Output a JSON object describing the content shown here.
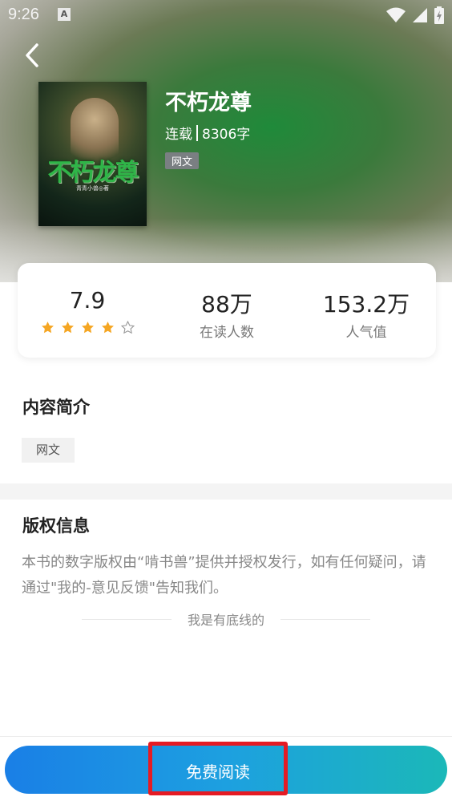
{
  "status_bar": {
    "time": "9:26",
    "notification_icon": "A"
  },
  "book": {
    "title": "不朽龙尊",
    "status": "连载",
    "word_count": "8306字",
    "tag": "网文",
    "cover_title": "不朽龙尊",
    "cover_author": "青青小兽◎著"
  },
  "stats": {
    "rating": "7.9",
    "rating_stars": 4,
    "readers_value": "88万",
    "readers_label": "在读人数",
    "popularity_value": "153.2万",
    "popularity_label": "人气值"
  },
  "intro": {
    "title": "内容简介",
    "tag": "网文"
  },
  "copyright": {
    "title": "版权信息",
    "text": "本书的数字版权由“啃书兽”提供并授权发行，如有任何疑问，请通过\"我的-意见反馈\"告知我们。"
  },
  "end_marker": "我是有底线的",
  "read_button": "免费阅读",
  "colors": {
    "accent_blue": "#1a7fe6",
    "accent_teal": "#1bb8b8",
    "highlight_red": "#e51b24",
    "star_orange": "#f5a623"
  }
}
